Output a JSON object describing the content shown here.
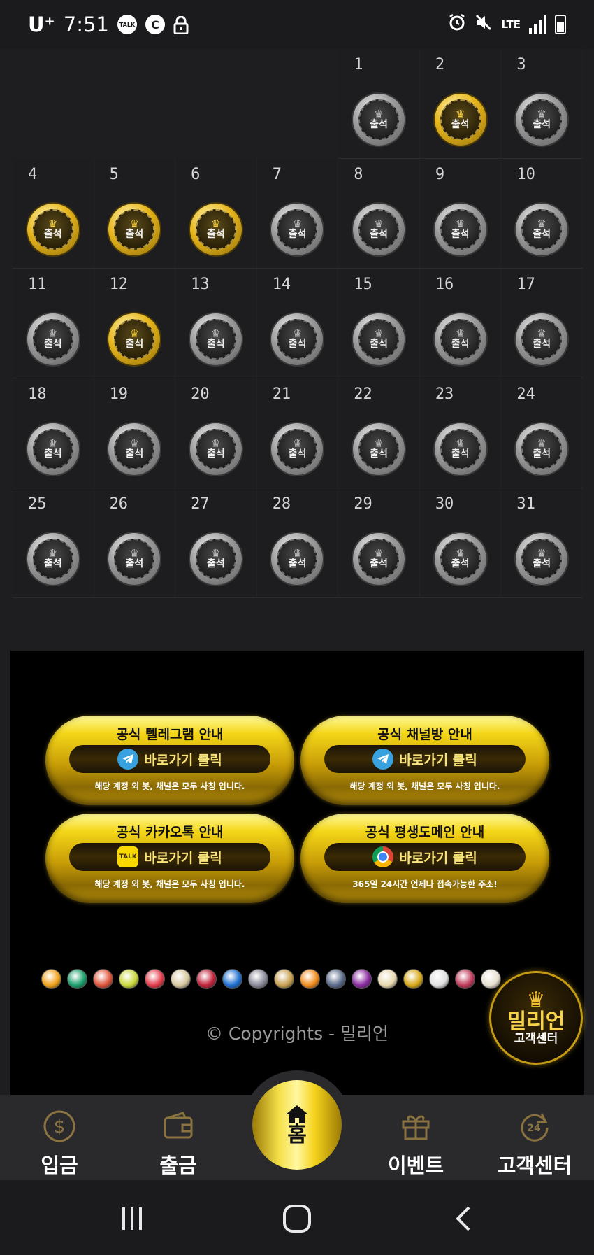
{
  "status_bar": {
    "carrier": "U⁺",
    "time": "7:51",
    "talk_icon": "TALK",
    "c_icon": "C",
    "lte": "LTE"
  },
  "calendar": {
    "checkin_label": "출석",
    "weeks": [
      [
        null,
        null,
        null,
        null,
        {
          "day": "1",
          "checked": false
        },
        {
          "day": "2",
          "checked": true
        },
        {
          "day": "3",
          "checked": false
        }
      ],
      [
        {
          "day": "4",
          "checked": true
        },
        {
          "day": "5",
          "checked": true
        },
        {
          "day": "6",
          "checked": true
        },
        {
          "day": "7",
          "checked": false
        },
        {
          "day": "8",
          "checked": false
        },
        {
          "day": "9",
          "checked": false
        },
        {
          "day": "10",
          "checked": false
        }
      ],
      [
        {
          "day": "11",
          "checked": false
        },
        {
          "day": "12",
          "checked": true
        },
        {
          "day": "13",
          "checked": false
        },
        {
          "day": "14",
          "checked": false
        },
        {
          "day": "15",
          "checked": false
        },
        {
          "day": "16",
          "checked": false
        },
        {
          "day": "17",
          "checked": false
        }
      ],
      [
        {
          "day": "18",
          "checked": false
        },
        {
          "day": "19",
          "checked": false
        },
        {
          "day": "20",
          "checked": false
        },
        {
          "day": "21",
          "checked": false
        },
        {
          "day": "22",
          "checked": false
        },
        {
          "day": "23",
          "checked": false
        },
        {
          "day": "24",
          "checked": false
        }
      ],
      [
        {
          "day": "25",
          "checked": false
        },
        {
          "day": "26",
          "checked": false
        },
        {
          "day": "27",
          "checked": false
        },
        {
          "day": "28",
          "checked": false
        },
        {
          "day": "29",
          "checked": false
        },
        {
          "day": "30",
          "checked": false
        },
        {
          "day": "31",
          "checked": false
        }
      ]
    ]
  },
  "banners": [
    {
      "title": "공식 텔레그램 안내",
      "button": "바로가기 클릭",
      "note": "해당 계정 외 봇, 채널은 모두 사칭 입니다.",
      "icon": "telegram-icon"
    },
    {
      "title": "공식 채널방 안내",
      "button": "바로가기 클릭",
      "note": "해당 계정 외 봇, 채널은 모두 사칭 입니다.",
      "icon": "telegram-icon"
    },
    {
      "title": "공식 카카오톡 안내",
      "button": "바로가기 클릭",
      "note": "해당 계정 외 봇, 채널은 모두 사칭 입니다.",
      "icon": "kakaotalk-icon",
      "icon_text": "TALK"
    },
    {
      "title": "공식 평생도메인 안내",
      "button": "바로가기 클릭",
      "note": "365일 24시간 언제나 접속가능한 주소!",
      "icon": "chrome-icon"
    }
  ],
  "providers": [
    "#f0a019",
    "#1a9f6b",
    "#e0543a",
    "#c9d83a",
    "#e33b4a",
    "#d8c8a0",
    "#c0223a",
    "#1e6fd0",
    "#8a8a9a",
    "#c8a050",
    "#f08a1a",
    "#5a6a8a",
    "#8a2aa0",
    "#e8d8b0",
    "#d8a818",
    "#e0e0e0",
    "#c03a5a",
    "#e8e0d0"
  ],
  "copyright": "© Copyrights - 밀리언",
  "support_badge": {
    "title": "밀리언",
    "sub": "고객센터"
  },
  "bottom_nav": {
    "deposit": "입금",
    "withdraw": "출금",
    "home": "홈",
    "event": "이벤트",
    "support": "고객센터"
  },
  "colors": {
    "background": "#1e1e21",
    "gold": "#f4d618",
    "nav": "#2a2a2c"
  }
}
